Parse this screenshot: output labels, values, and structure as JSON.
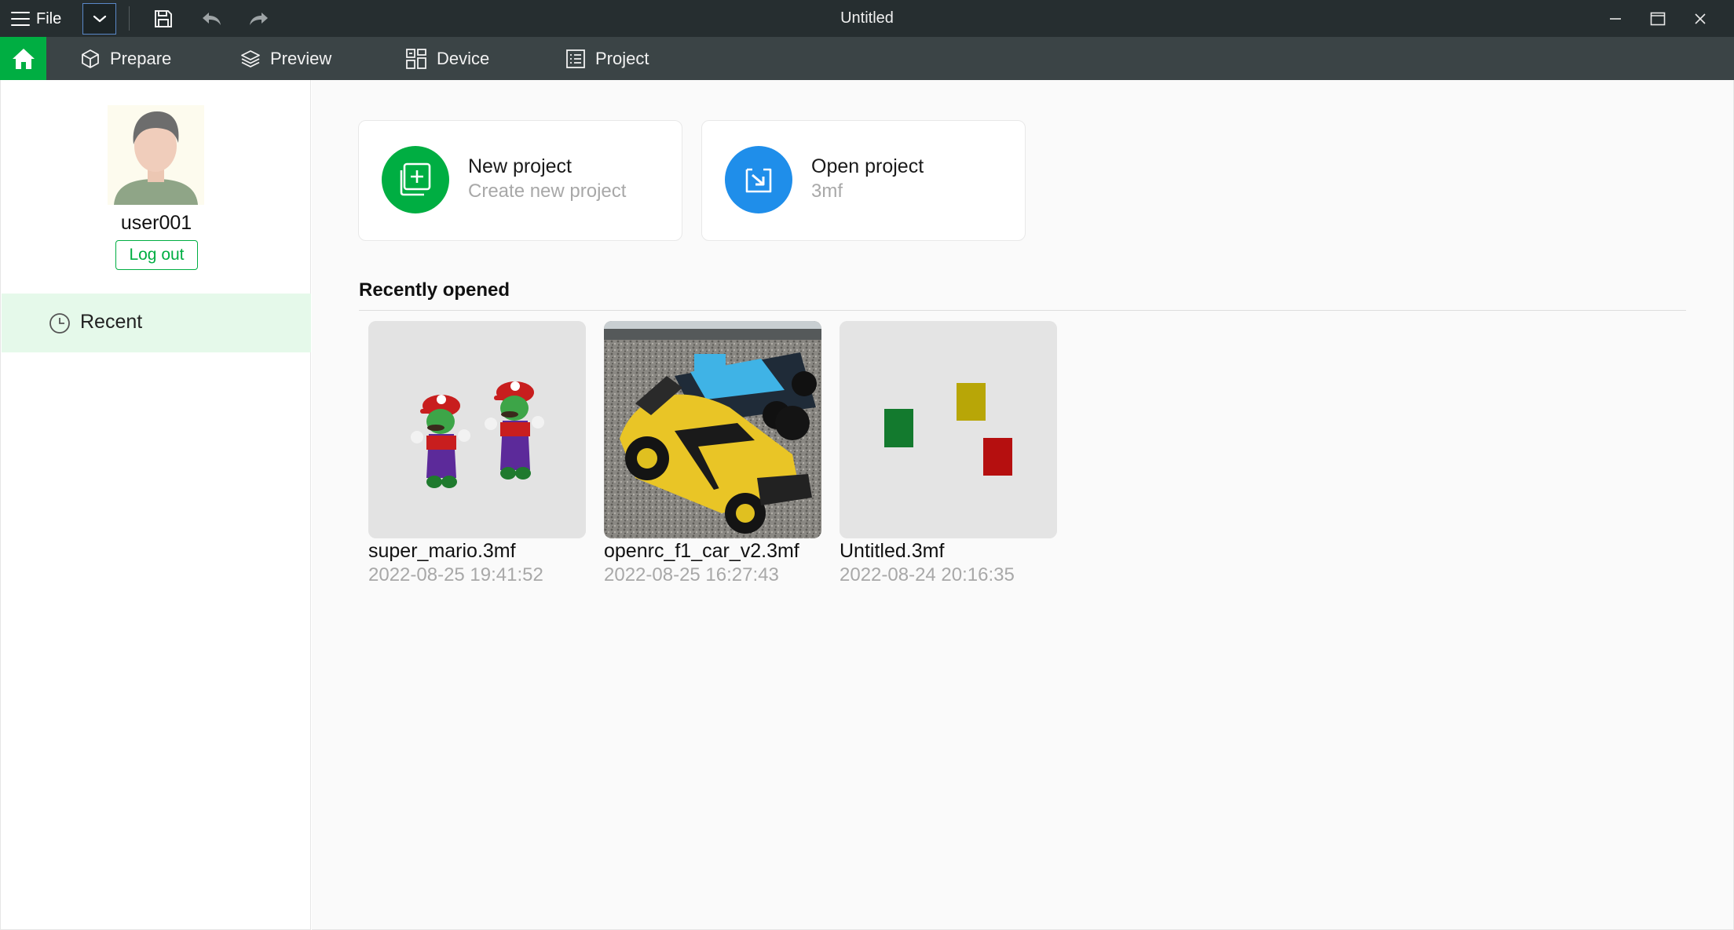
{
  "window": {
    "title": "Untitled",
    "file_menu_label": "File"
  },
  "tabs": [
    {
      "label": "Prepare",
      "icon": "cube-icon"
    },
    {
      "label": "Preview",
      "icon": "layers-icon"
    },
    {
      "label": "Device",
      "icon": "device-icon"
    },
    {
      "label": "Project",
      "icon": "document-list-icon"
    }
  ],
  "sidebar": {
    "username": "user001",
    "logout_label": "Log out",
    "items": [
      {
        "label": "Recent",
        "icon": "clock-icon",
        "selected": true
      }
    ]
  },
  "actions": {
    "new_project": {
      "title": "New project",
      "subtitle": "Create new project"
    },
    "open_project": {
      "title": "Open project",
      "subtitle": "3mf"
    }
  },
  "recent": {
    "title": "Recently opened",
    "files": [
      {
        "name": "super_mario.3mf",
        "date": "2022-08-25 19:41:52"
      },
      {
        "name": "openrc_f1_car_v2.3mf",
        "date": "2022-08-25 16:27:43"
      },
      {
        "name": "Untitled.3mf",
        "date": "2022-08-24 20:16:35"
      }
    ]
  },
  "colors": {
    "accent_green": "#00ae42",
    "accent_blue": "#1f8eea",
    "titlebar": "#262e30",
    "tabbar": "#3b4446",
    "selected_bg": "#e5f9ea"
  }
}
